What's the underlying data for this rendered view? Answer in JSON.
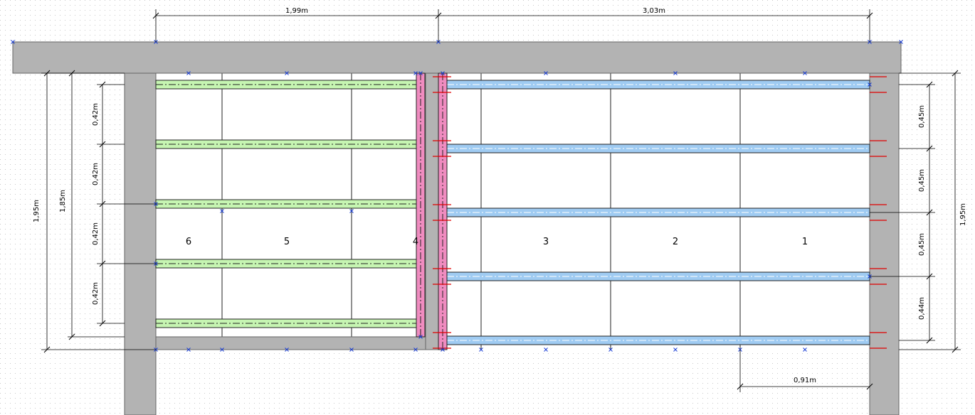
{
  "drawing": {
    "colors": {
      "background": "#ffffff",
      "grid_dot": "#c8c8c8",
      "wall": "#b3b3b3",
      "wall_edge": "#666666",
      "beam_left": "#c6f5b2",
      "beam_right": "#9fcbf2",
      "beam_outline": "#222222",
      "support_beam": "#f08cc0",
      "tick_red": "#e00000",
      "node_blue": "#1a3fd6"
    },
    "top_dimensions": [
      "1,99m",
      "3,03m"
    ],
    "left_dimensions": {
      "overall": "1,95m",
      "inner": "1,85m",
      "spacings": [
        "0,42m",
        "0,42m",
        "0,42m",
        "0,42m"
      ]
    },
    "right_dimensions": {
      "overall": "1,95m",
      "spacings": [
        "0,45m",
        "0,45m",
        "0,45m",
        "0,44m"
      ]
    },
    "bottom_dimension": "0,91m",
    "bay_labels": [
      "6",
      "5",
      "4",
      "3",
      "2",
      "1"
    ]
  }
}
